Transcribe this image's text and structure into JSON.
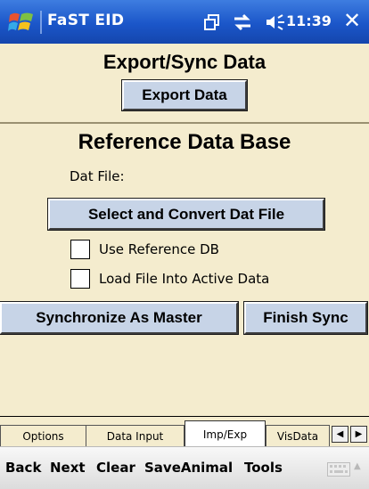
{
  "titlebar": {
    "app_title": "FaST EID",
    "clock": "11:39",
    "close_glyph": "✕",
    "icons": [
      "windows-flag-icon",
      "window-switch-icon",
      "connectivity-icon",
      "volume-icon",
      "close-icon"
    ]
  },
  "export_section": {
    "heading": "Export/Sync Data",
    "export_button": "Export Data"
  },
  "reference_section": {
    "heading": "Reference Data Base",
    "dat_file_label": "Dat File:",
    "select_convert_button": "Select and Convert Dat File",
    "use_reference_db_label": "Use Reference DB",
    "load_file_label": "Load File Into Active Data",
    "use_reference_db_checked": false,
    "load_file_checked": false,
    "sync_master_button": "Synchronize As Master",
    "finish_sync_button": "Finish Sync"
  },
  "tabs": [
    {
      "label": "Options",
      "active": false
    },
    {
      "label": "Data Input",
      "active": false
    },
    {
      "label": "Imp/Exp",
      "active": true
    },
    {
      "label": "VisData",
      "active": false
    }
  ],
  "tab_arrows": {
    "left": "◀",
    "right": "▶"
  },
  "menubar": {
    "items": [
      "Back",
      "Next",
      "Clear",
      "SaveAnimal",
      "Tools"
    ],
    "icons": [
      "keyboard-icon"
    ],
    "caret": "▲"
  },
  "colors": {
    "title_bar": "#1b56c9",
    "panel_bg": "#f4ecce",
    "button_bg": "#c7d4e7",
    "active_tab": "#ffffff"
  }
}
